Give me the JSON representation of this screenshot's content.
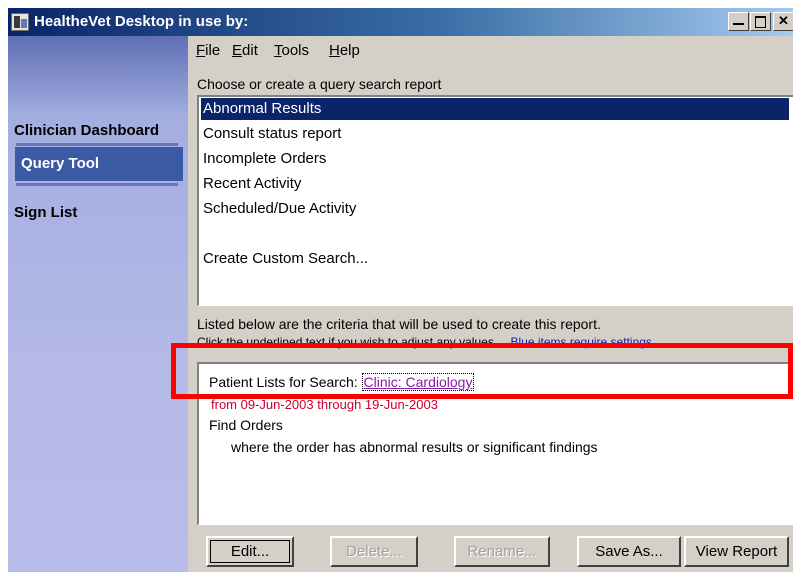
{
  "window": {
    "title": "HealtheVet Desktop in use by:"
  },
  "sidebar": {
    "items": [
      {
        "label": "Clinician Dashboard"
      },
      {
        "label": "Query Tool"
      },
      {
        "label": "Sign List"
      }
    ]
  },
  "menu": {
    "items": [
      {
        "label": "File",
        "mnemonic": "F"
      },
      {
        "label": "Edit",
        "mnemonic": "E"
      },
      {
        "label": "Tools",
        "mnemonic": "T"
      },
      {
        "label": "Help",
        "mnemonic": "H"
      }
    ]
  },
  "report_list": {
    "heading": "Choose or create a query search report",
    "items": [
      {
        "label": "Abnormal Results",
        "selected": true
      },
      {
        "label": "Consult status report"
      },
      {
        "label": "Incomplete Orders"
      },
      {
        "label": "Recent Activity"
      },
      {
        "label": "Scheduled/Due Activity"
      },
      {
        "label": "Create Custom Search..."
      }
    ]
  },
  "criteria": {
    "heading": "Listed below are the criteria that will be used to create this report.",
    "instruction": "Click the underlined text if you wish to adjust any values.",
    "instruction_link": "Blue items require settings",
    "patient_label": "Patient Lists for Search:",
    "patient_value": "Clinic: Cardiology",
    "date_range": "from 09-Jun-2003 through 19-Jun-2003",
    "find_label": "Find Orders",
    "find_condition": "where the order has abnormal results or significant findings"
  },
  "buttons": {
    "edit": "Edit...",
    "delete": "Delete...",
    "rename": "Rename...",
    "save_as": "Save As...",
    "view_report": "View Report"
  },
  "colors": {
    "title_bar": "#0a246a",
    "sidebar": "#b4b9e6",
    "selection": "#0a246a",
    "highlight": "#ff0000",
    "link": "#8a1aa8",
    "date": "#cc0033"
  },
  "icons": [
    "app-icon",
    "minimize-icon",
    "maximize-icon",
    "close-icon"
  ]
}
